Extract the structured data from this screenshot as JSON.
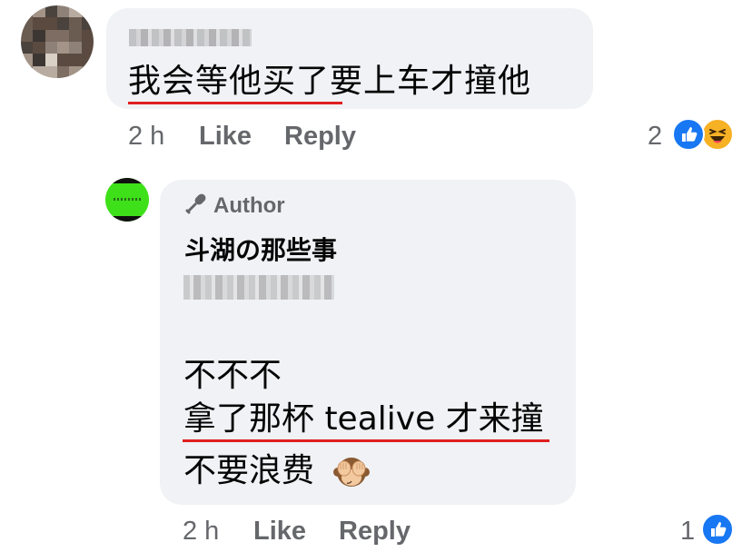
{
  "comment": {
    "text": "我会等他买了要上车才撞他",
    "time": "2 h",
    "like_label": "Like",
    "reply_label": "Reply",
    "reaction_count": "2",
    "reactions": [
      "like-icon",
      "haha-icon"
    ]
  },
  "reply": {
    "author_badge": "Author",
    "page_name": "斗湖の那些事",
    "lines": [
      "不不不",
      "拿了那杯 tealive 才来撞",
      "不要浪费"
    ],
    "emoji": "see-no-evil-monkey-icon",
    "time": "2 h",
    "like_label": "Like",
    "reply_label": "Reply",
    "reaction_count": "1",
    "reactions": [
      "like-icon"
    ]
  },
  "colors": {
    "bubble": "#f0f2f5",
    "secondary_text": "#65676b",
    "underline": "#e02020",
    "like_blue": "#1877f2",
    "haha_yellow": "#f7b125",
    "page_avatar_green": "#3ee019"
  }
}
